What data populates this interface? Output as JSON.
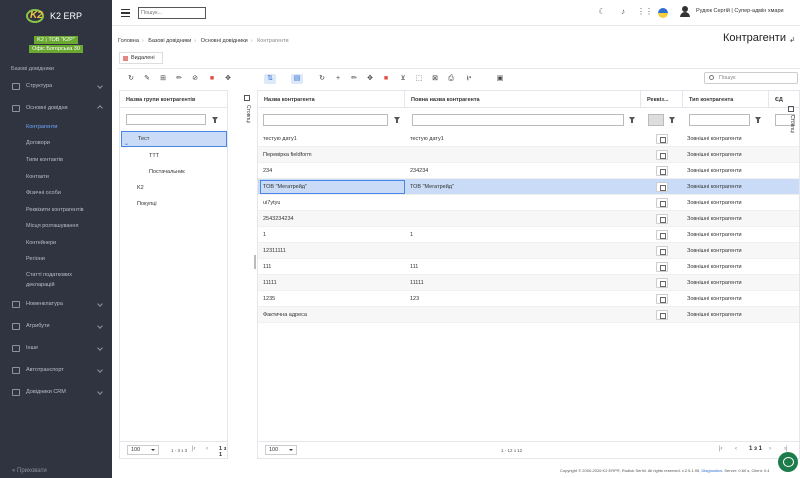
{
  "app": {
    "name": "K2 ERP"
  },
  "org": {
    "line1": "K2 | ТОВ \"К2Р\"",
    "line2": "Офіс Богорська 30"
  },
  "sidebar": {
    "section_title": "Базові довідники",
    "items": [
      {
        "label": "Структура",
        "icon": "structure-icon"
      },
      {
        "label": "Основні довідни",
        "icon": "book-icon"
      },
      {
        "label": "Номенклатура",
        "icon": "box-icon"
      },
      {
        "label": "Атрибути",
        "icon": "tag-icon"
      },
      {
        "label": "Інше",
        "icon": "folder-icon"
      },
      {
        "label": "Автотранспорт",
        "icon": "car-icon"
      },
      {
        "label": "Довідники CRM",
        "icon": "crm-icon"
      }
    ],
    "subitems": [
      "Контрагенти",
      "Договори",
      "Типи контактів",
      "Контакти",
      "Фізичні особи",
      "Реквізити контрагентів",
      "Місця розташування",
      "Контейнери",
      "Регіони",
      "Статті податкових",
      "декларацій"
    ],
    "collapse_label": "Приховати"
  },
  "topbar": {
    "search_placeholder": "Пошук...",
    "user": "Рудюк Сергій | Супер-адмін хмари"
  },
  "breadcrumb": [
    "Головна",
    "Базові довідники",
    "Основні довідники",
    "Контрагенти"
  ],
  "page": {
    "title": "Контрагенти"
  },
  "tab": {
    "label": "Видалені"
  },
  "search_filter_placeholder": "Пошук",
  "columns_label": "Стовпці",
  "left_grid": {
    "header": "Назва групи контрагентів",
    "rows": [
      {
        "label": "Тест",
        "level": 0
      },
      {
        "label": "ТТТ",
        "level": 2
      },
      {
        "label": "Постачальник",
        "level": 2
      },
      {
        "label": "K2",
        "level": 0
      },
      {
        "label": "Покупці",
        "level": 0
      }
    ],
    "page_size": "100",
    "range": "1 - 3 з 3",
    "page": "1 з 1"
  },
  "main_grid": {
    "headers": [
      "Назва контрагента",
      "Повна назва контрагента",
      "Реквіз...",
      "Тип контрагента",
      "ЄД"
    ],
    "rows": [
      {
        "name": "тестую дату1",
        "full": "тестую дату1",
        "type": "Зовнішні контрагенти"
      },
      {
        "name": "Перевірка fieldform",
        "full": "",
        "type": "Зовнішні контрагенти"
      },
      {
        "name": "234",
        "full": "234234",
        "type": "Зовнішні контрагенти"
      },
      {
        "name": "ТОВ \"Мегатрейд\"",
        "full": "ТОВ \"Мегатрейд\"",
        "type": "Зовнішні контрагенти"
      },
      {
        "name": "ui7ytyu",
        "full": "",
        "type": "Зовнішні контрагенти"
      },
      {
        "name": "2543234234",
        "full": "",
        "type": "Зовнішні контрагенти"
      },
      {
        "name": "1",
        "full": "1",
        "type": "Зовнішні контрагенти"
      },
      {
        "name": "12311111",
        "full": "",
        "type": "Зовнішні контрагенти"
      },
      {
        "name": "111",
        "full": "111",
        "type": "Зовнішні контрагенти"
      },
      {
        "name": "11111",
        "full": "11111",
        "type": "Зовнішні контрагенти"
      },
      {
        "name": "1235",
        "full": "123",
        "type": "Зовнішні контрагенти"
      },
      {
        "name": "Фактична адреса",
        "full": "",
        "type": "Зовнішні контрагенти"
      }
    ],
    "page_size": "100",
    "range": "1 - 12 з 12",
    "page": "1 з 1"
  },
  "footer": {
    "copyright": "Copyright © 2000-2026 K2 ERP®, Rudiuk Serhii. All rights reserved. v.2.5.1.95,",
    "diagnostics": "Diagnostics",
    "server": ". Server: 0.60 s, Client: 0.4"
  }
}
